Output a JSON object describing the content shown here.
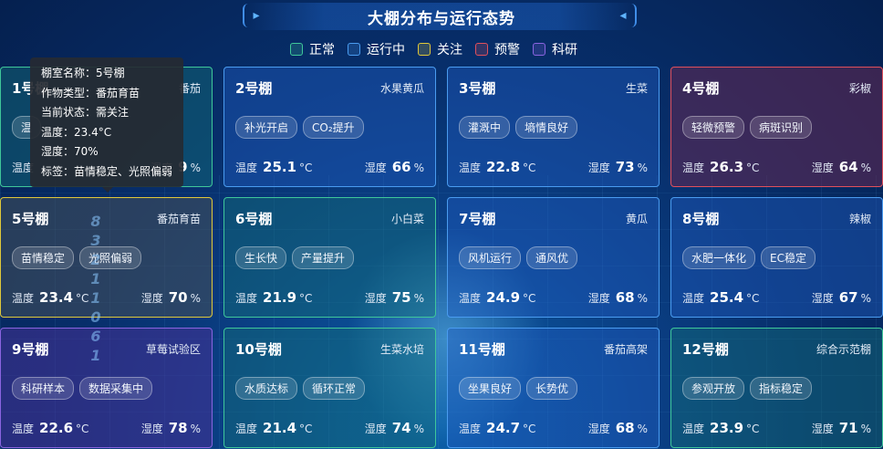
{
  "header": {
    "title": "大棚分布与运行态势",
    "left_icon": "chevron-right-icon",
    "right_icon": "chevron-left-icon"
  },
  "legend": [
    {
      "label": "正常",
      "color": "#3fc79a"
    },
    {
      "label": "运行中",
      "color": "#4a9cf0"
    },
    {
      "label": "关注",
      "color": "#e0c83a"
    },
    {
      "label": "预警",
      "color": "#e0505c"
    },
    {
      "label": "科研",
      "color": "#8a64e0"
    }
  ],
  "labels": {
    "temp": "温度",
    "humidity": "湿度",
    "temp_unit": "°C",
    "humidity_unit": "%"
  },
  "greenhouses": [
    {
      "name": "1号棚",
      "crop": "番茄",
      "status": "normal",
      "tags": [
        "温"
      ],
      "temp": "",
      "humidity": "9"
    },
    {
      "name": "2号棚",
      "crop": "水果黄瓜",
      "status": "running",
      "tags": [
        "补光开启",
        "CO₂提升"
      ],
      "temp": "25.1",
      "humidity": "66"
    },
    {
      "name": "3号棚",
      "crop": "生菜",
      "status": "running",
      "tags": [
        "灌溉中",
        "墒情良好"
      ],
      "temp": "22.8",
      "humidity": "73"
    },
    {
      "name": "4号棚",
      "crop": "彩椒",
      "status": "warning",
      "tags": [
        "轻微预警",
        "病斑识别"
      ],
      "temp": "26.3",
      "humidity": "64"
    },
    {
      "name": "5号棚",
      "crop": "番茄育苗",
      "status": "attention",
      "tags": [
        "苗情稳定",
        "光照偏弱"
      ],
      "temp": "23.4",
      "humidity": "70"
    },
    {
      "name": "6号棚",
      "crop": "小白菜",
      "status": "normal",
      "tags": [
        "生长快",
        "产量提升"
      ],
      "temp": "21.9",
      "humidity": "75"
    },
    {
      "name": "7号棚",
      "crop": "黄瓜",
      "status": "running",
      "tags": [
        "风机运行",
        "通风优"
      ],
      "temp": "24.9",
      "humidity": "68"
    },
    {
      "name": "8号棚",
      "crop": "辣椒",
      "status": "running",
      "tags": [
        "水肥一体化",
        "EC稳定"
      ],
      "temp": "25.4",
      "humidity": "67"
    },
    {
      "name": "9号棚",
      "crop": "草莓试验区",
      "status": "research",
      "tags": [
        "科研样本",
        "数据采集中"
      ],
      "temp": "22.6",
      "humidity": "78"
    },
    {
      "name": "10号棚",
      "crop": "生菜水培",
      "status": "normal",
      "tags": [
        "水质达标",
        "循环正常"
      ],
      "temp": "21.4",
      "humidity": "74"
    },
    {
      "name": "11号棚",
      "crop": "番茄高架",
      "status": "running",
      "tags": [
        "坐果良好",
        "长势优"
      ],
      "temp": "24.7",
      "humidity": "68"
    },
    {
      "name": "12号棚",
      "crop": "综合示范棚",
      "status": "normal",
      "tags": [
        "参观开放",
        "指标稳定"
      ],
      "temp": "23.9",
      "humidity": "71"
    }
  ],
  "tooltip": {
    "lines": [
      "棚室名称：5号棚",
      "作物类型：番茄育苗",
      "当前状态：需关注",
      "温度：23.4°C",
      "湿度：70%",
      "标签：苗情稳定、光照偏弱"
    ]
  },
  "decor_digits": [
    "8",
    "3",
    "2",
    "1",
    "1",
    "0",
    "6",
    "1"
  ]
}
